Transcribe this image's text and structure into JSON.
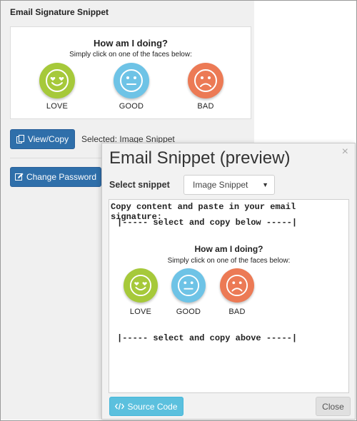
{
  "panel": {
    "title": "Email Signature Snippet",
    "widget": {
      "title": "How am I doing?",
      "subtitle": "Simply click on one of the faces below:",
      "faces": [
        {
          "label": "LOVE",
          "icon": "heart-eyes-face-icon",
          "color": "#a6c93a"
        },
        {
          "label": "GOOD",
          "icon": "neutral-face-icon",
          "color": "#6ec3e6"
        },
        {
          "label": "BAD",
          "icon": "sad-face-icon",
          "color": "#ec7a55"
        }
      ]
    },
    "view_copy_label": "View/Copy",
    "selected_text": "Selected: Image Snippet",
    "change_password_label": "Change Password"
  },
  "modal": {
    "title": "Email Snippet (preview)",
    "close_glyph": "×",
    "select_label": "Select snippet",
    "select_value": "Image Snippet",
    "copy_instruction": "Copy content and paste in your email signature:",
    "marker_top": "|----- select and copy below -----|",
    "marker_bottom": "|----- select and copy above -----|",
    "source_code_label": "Source Code",
    "close_label": "Close"
  },
  "colors": {
    "primary": "#2f6faa",
    "info": "#5bc0de",
    "love": "#a6c93a",
    "good": "#6ec3e6",
    "bad": "#ec7a55"
  }
}
